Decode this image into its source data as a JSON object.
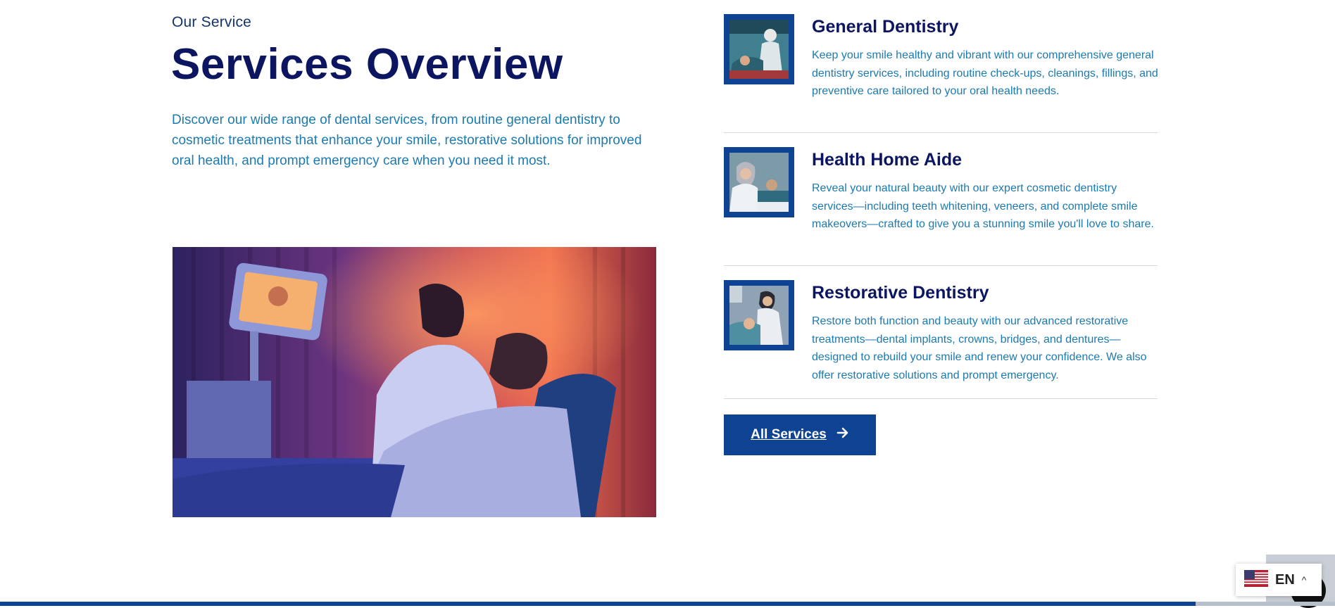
{
  "header": {
    "eyebrow": "Our Service",
    "title": "Services Overview",
    "intro": "Discover our wide range of dental services, from routine general dentistry to cosmetic treatments that enhance your smile, restorative solutions for improved oral health, and prompt emergency care when you need it most."
  },
  "services": [
    {
      "title": "General Dentistry",
      "description": "Keep your smile healthy and vibrant with our comprehensive general dentistry services, including routine check-ups, cleanings, fillings, and preventive care tailored to your oral health needs."
    },
    {
      "title": "Health Home Aide",
      "description": "Reveal your natural beauty with our expert cosmetic dentistry services—including teeth whitening, veneers, and complete smile makeovers—crafted to give you a stunning smile you'll love to share."
    },
    {
      "title": "Restorative Dentistry",
      "description": "Restore both function and beauty with our advanced restorative treatments—dental implants, crowns, bridges, and dentures—designed to rebuild your smile and renew your confidence. We also offer restorative solutions and prompt emergency."
    }
  ],
  "cta": {
    "label": "All Services",
    "icon": "arrow-right-icon"
  },
  "language": {
    "code": "EN",
    "flag": "us-flag-icon",
    "caret": "^"
  },
  "colors": {
    "navy": "#0c1560",
    "brand_blue": "#0d4392",
    "text_blue": "#1c7ab0"
  }
}
